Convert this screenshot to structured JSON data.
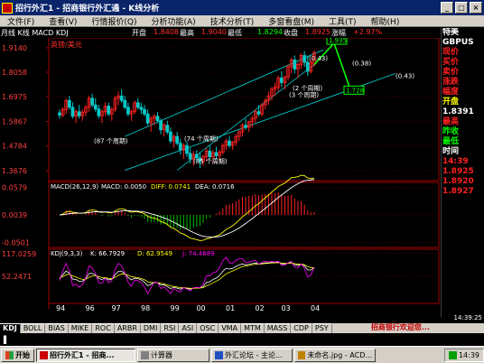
{
  "window": {
    "title": "招行外汇1 - 招商银行外汇通 - K线分析"
  },
  "menu": [
    "文件(F)",
    "查看(V)",
    "行情报价(Q)",
    "分析功能(A)",
    "技术分析(T)",
    "多窗看盘(M)",
    "工具(T)",
    "帮助(H)"
  ],
  "infobar": {
    "period": "月线 K线 MACD KDJ",
    "open_label": "开盘",
    "open": "1.8408",
    "high_label": "最高",
    "high": "1.9040",
    "low_label": "最低",
    "low": "1.8294",
    "close_label": "收盘",
    "close": "1.8925",
    "change_label": "涨幅",
    "change": "+2.97%"
  },
  "main_chart": {
    "legend": "英镑/美元",
    "y_ticks": [
      "1.9140",
      "1.8058",
      "1.6975",
      "1.5867",
      "1.4784",
      "1.3676"
    ],
    "annotations": [
      "(87 个周期)",
      "(74 个周期)",
      "(85 个周期)",
      "(2 个周期)",
      "(3 个周期)",
      "(0.43)",
      "(0.38)",
      "(0.43)",
      "1.935",
      "1.728"
    ],
    "candles": [
      [
        1.625,
        1.64,
        1.6,
        1.615
      ],
      [
        1.615,
        1.65,
        1.605,
        1.64
      ],
      [
        1.64,
        1.69,
        1.62,
        1.68
      ],
      [
        1.68,
        1.7,
        1.64,
        1.65
      ],
      [
        1.65,
        1.672,
        1.6,
        1.61
      ],
      [
        1.61,
        1.64,
        1.58,
        1.63
      ],
      [
        1.63,
        1.66,
        1.6,
        1.612
      ],
      [
        1.612,
        1.64,
        1.59,
        1.628
      ],
      [
        1.628,
        1.66,
        1.61,
        1.65
      ],
      [
        1.65,
        1.7,
        1.63,
        1.69
      ],
      [
        1.69,
        1.71,
        1.65,
        1.66
      ],
      [
        1.66,
        1.69,
        1.63,
        1.642
      ],
      [
        1.642,
        1.66,
        1.6,
        1.612
      ],
      [
        1.612,
        1.64,
        1.58,
        1.63
      ],
      [
        1.63,
        1.672,
        1.61,
        1.655
      ],
      [
        1.655,
        1.67,
        1.61,
        1.62
      ],
      [
        1.62,
        1.65,
        1.59,
        1.64
      ],
      [
        1.64,
        1.7,
        1.63,
        1.69
      ],
      [
        1.69,
        1.72,
        1.66,
        1.7
      ],
      [
        1.7,
        1.73,
        1.67,
        1.68
      ],
      [
        1.68,
        1.7,
        1.64,
        1.65
      ],
      [
        1.65,
        1.67,
        1.61,
        1.62
      ],
      [
        1.62,
        1.64,
        1.59,
        1.63
      ],
      [
        1.63,
        1.68,
        1.62,
        1.67
      ],
      [
        1.67,
        1.69,
        1.64,
        1.65
      ],
      [
        1.65,
        1.67,
        1.62,
        1.64
      ],
      [
        1.64,
        1.66,
        1.61,
        1.62
      ],
      [
        1.62,
        1.64,
        1.57,
        1.58
      ],
      [
        1.58,
        1.61,
        1.54,
        1.6
      ],
      [
        1.6,
        1.62,
        1.57,
        1.61
      ],
      [
        1.61,
        1.63,
        1.58,
        1.59
      ],
      [
        1.59,
        1.6,
        1.53,
        1.55
      ],
      [
        1.55,
        1.58,
        1.52,
        1.57
      ],
      [
        1.57,
        1.59,
        1.53,
        1.54
      ],
      [
        1.54,
        1.56,
        1.49,
        1.5
      ],
      [
        1.5,
        1.53,
        1.47,
        1.52
      ],
      [
        1.52,
        1.54,
        1.48,
        1.49
      ],
      [
        1.49,
        1.51,
        1.44,
        1.46
      ],
      [
        1.46,
        1.49,
        1.42,
        1.48
      ],
      [
        1.48,
        1.5,
        1.43,
        1.445
      ],
      [
        1.445,
        1.47,
        1.4,
        1.42
      ],
      [
        1.42,
        1.455,
        1.39,
        1.44
      ],
      [
        1.44,
        1.46,
        1.41,
        1.425
      ],
      [
        1.425,
        1.45,
        1.38,
        1.41
      ],
      [
        1.41,
        1.44,
        1.39,
        1.43
      ],
      [
        1.43,
        1.47,
        1.41,
        1.455
      ],
      [
        1.455,
        1.48,
        1.42,
        1.43
      ],
      [
        1.43,
        1.46,
        1.4,
        1.448
      ],
      [
        1.448,
        1.475,
        1.42,
        1.435
      ],
      [
        1.435,
        1.46,
        1.41,
        1.45
      ],
      [
        1.45,
        1.49,
        1.44,
        1.48
      ],
      [
        1.48,
        1.51,
        1.46,
        1.5
      ],
      [
        1.5,
        1.52,
        1.47,
        1.48
      ],
      [
        1.48,
        1.5,
        1.46,
        1.495
      ],
      [
        1.495,
        1.53,
        1.48,
        1.52
      ],
      [
        1.52,
        1.55,
        1.5,
        1.54
      ],
      [
        1.54,
        1.58,
        1.52,
        1.57
      ],
      [
        1.57,
        1.6,
        1.55,
        1.56
      ],
      [
        1.56,
        1.59,
        1.54,
        1.585
      ],
      [
        1.585,
        1.61,
        1.56,
        1.6
      ],
      [
        1.6,
        1.64,
        1.58,
        1.63
      ],
      [
        1.63,
        1.66,
        1.61,
        1.62
      ],
      [
        1.62,
        1.67,
        1.61,
        1.66
      ],
      [
        1.66,
        1.69,
        1.64,
        1.68
      ],
      [
        1.68,
        1.72,
        1.66,
        1.7
      ],
      [
        1.7,
        1.74,
        1.68,
        1.73
      ],
      [
        1.73,
        1.76,
        1.7,
        1.74
      ],
      [
        1.74,
        1.79,
        1.72,
        1.78
      ],
      [
        1.78,
        1.81,
        1.74,
        1.76
      ],
      [
        1.76,
        1.79,
        1.73,
        1.785
      ],
      [
        1.785,
        1.84,
        1.77,
        1.83
      ],
      [
        1.83,
        1.87,
        1.8,
        1.86
      ],
      [
        1.86,
        1.88,
        1.8,
        1.82
      ],
      [
        1.82,
        1.85,
        1.78,
        1.84
      ],
      [
        1.84,
        1.89,
        1.82,
        1.88
      ],
      [
        1.88,
        1.9,
        1.83,
        1.85
      ],
      [
        1.85,
        1.88,
        1.79,
        1.81
      ],
      [
        1.81,
        1.86,
        1.8,
        1.85
      ],
      [
        1.841,
        1.904,
        1.829,
        1.8925
      ]
    ]
  },
  "macd": {
    "legend": "MACD(26,12,9)",
    "macd_label": "MACD: 0.0050",
    "diff_label": "DIFF: 0.0741",
    "dea_label": "DEA: 0.0716",
    "y_ticks": [
      "0.0579",
      "0.0039",
      "-0.0501"
    ]
  },
  "kdj": {
    "legend": "KDJ(9,3,3)",
    "k_label": "K: 66.7929",
    "d_label": "D: 62.9549",
    "j_label": "J: 74.4689",
    "y_ticks": [
      "117.0259",
      "52.2471"
    ]
  },
  "x_axis": [
    "94",
    "96",
    "97",
    "98",
    "99",
    "00",
    "01",
    "02",
    "03",
    "04"
  ],
  "right_panel": [
    {
      "text": "特美",
      "color": "#ffffff"
    },
    {
      "text": "GBPUS",
      "color": "#ffffff"
    },
    {
      "text": "现价",
      "color": "#ff2020"
    },
    {
      "text": "买价",
      "color": "#ff2020"
    },
    {
      "text": "卖价",
      "color": "#ff2020"
    },
    {
      "text": "涨跌",
      "color": "#ff2020"
    },
    {
      "text": "幅度",
      "color": "#ff2020"
    },
    {
      "text": "开盘",
      "color": "#ffff00"
    },
    {
      "text": "1.8391",
      "color": "#ffffff"
    },
    {
      "text": "最高",
      "color": "#ff2020"
    },
    {
      "text": "昨收",
      "color": "#00ff00"
    },
    {
      "text": "最低",
      "color": "#00ff00"
    },
    {
      "text": "时间",
      "color": "#ffffff"
    },
    {
      "text": "14:39",
      "color": "#ff2020"
    },
    {
      "text": "1.8925",
      "color": "#ff2020"
    },
    {
      "text": "1.8920",
      "color": "#ff2020"
    },
    {
      "text": "1.8927",
      "color": "#ff2020"
    }
  ],
  "clock": "14:39:25",
  "tabs": [
    "KDJ",
    "BOLL",
    "BIAS",
    "MIKE",
    "ROC",
    "ARBR",
    "DMI",
    "RSI",
    "ASI",
    "OSC",
    "VMA",
    "MTM",
    "MASS",
    "CDP",
    "PSY"
  ],
  "tab_status": "招商银行欢迎您...",
  "taskbar": {
    "start": "开始",
    "buttons": [
      "招行外汇1 - 招商...",
      "计算器",
      "外汇论坛 - 主论...",
      "未命名.jpg - ACD..."
    ],
    "time": "14:39"
  },
  "colors": {
    "title_bg": "#0a246a",
    "channel": "#00c8c8",
    "up": "#ff2020",
    "down": "#00c8c8",
    "forecast": "#00ff00",
    "k_line": "#ffffff",
    "d_line": "#ffff00",
    "j_line": "#ff00ff"
  }
}
